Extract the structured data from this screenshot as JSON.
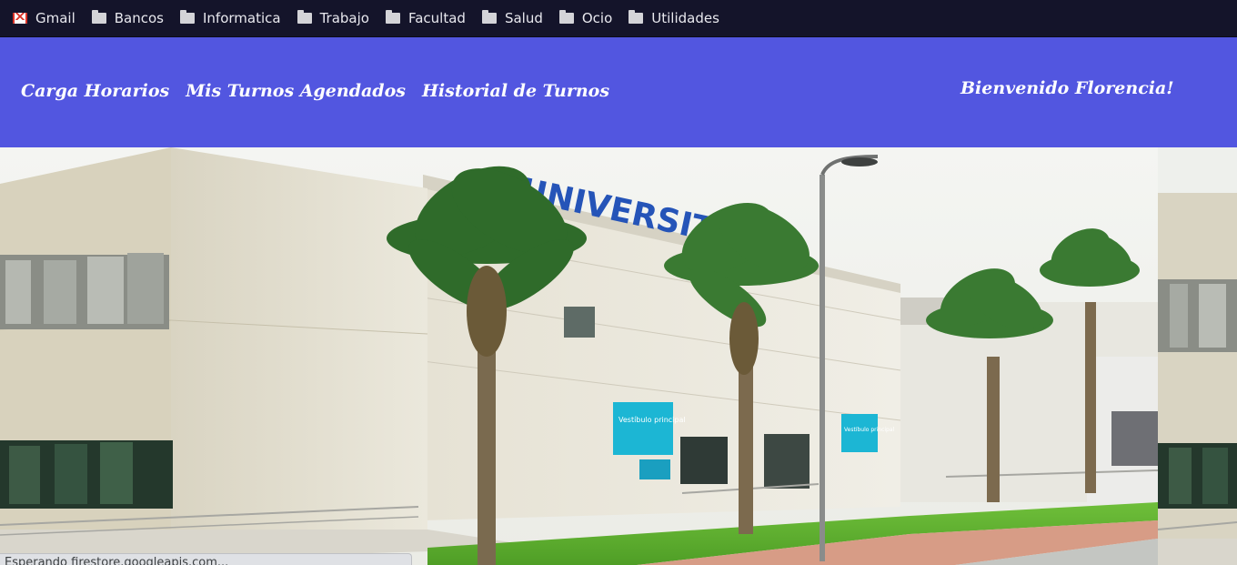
{
  "bookmarks": [
    {
      "label": "Gmail",
      "icon": "gmail-icon"
    },
    {
      "label": "Bancos",
      "icon": "folder-icon"
    },
    {
      "label": "Informatica",
      "icon": "folder-icon"
    },
    {
      "label": "Trabajo",
      "icon": "folder-icon"
    },
    {
      "label": "Facultad",
      "icon": "folder-icon"
    },
    {
      "label": "Salud",
      "icon": "folder-icon"
    },
    {
      "label": "Ocio",
      "icon": "folder-icon"
    },
    {
      "label": "Utilidades",
      "icon": "folder-icon"
    }
  ],
  "nav": {
    "links": [
      "Carga Horarios",
      "Mis Turnos Agendados",
      "Historial de Turnos"
    ],
    "welcome": "Bienvenido Florencia!"
  },
  "hero": {
    "sign_text": "UNIVERSITARIO",
    "panel_1": "Vestíbulo principal",
    "panel_2": "Vestíbulo principal"
  },
  "status": {
    "text": "Esperando firestore.googleapis.com..."
  },
  "colors": {
    "header_bg": "#5256e0",
    "bookmarks_bg": "#14142a",
    "sign_blue": "#2554b8",
    "panel_cyan": "#1cb6d4"
  }
}
